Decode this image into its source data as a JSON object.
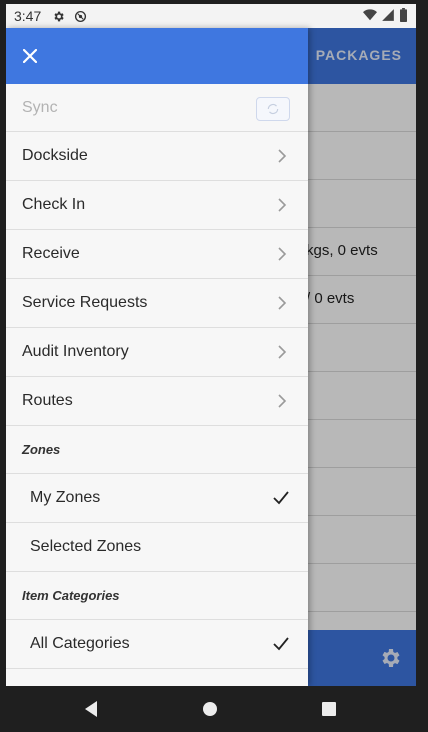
{
  "status_bar": {
    "time": "3:47",
    "icons": [
      "settings-icon",
      "sync-status-icon",
      "wifi-icon",
      "signal-icon",
      "battery-icon"
    ]
  },
  "background_app": {
    "header_tab": "PACKAGES",
    "rows": [
      "",
      "",
      "",
      "kgs, 0 evts",
      "/ 0 evts",
      "",
      "",
      "",
      "",
      "",
      ""
    ],
    "accent_color": "#3f77e0"
  },
  "drawer": {
    "close_icon": "close-icon",
    "sync_label": "Sync",
    "menu_items": [
      {
        "label": "Dockside"
      },
      {
        "label": "Check In"
      },
      {
        "label": "Receive"
      },
      {
        "label": "Service Requests"
      },
      {
        "label": "Audit Inventory"
      },
      {
        "label": "Routes"
      }
    ],
    "zones": {
      "heading": "Zones",
      "options": [
        {
          "label": "My Zones",
          "selected": true
        },
        {
          "label": "Selected Zones",
          "selected": false
        }
      ]
    },
    "item_categories": {
      "heading": "Item Categories",
      "options": [
        {
          "label": "All Categories",
          "selected": true
        }
      ]
    }
  }
}
